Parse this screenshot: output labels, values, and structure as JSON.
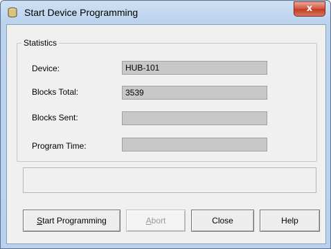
{
  "window": {
    "title": "Start Device Programming",
    "close_glyph": "x"
  },
  "statistics": {
    "legend": "Statistics",
    "rows": [
      {
        "label": "Device:",
        "value": "HUB-101"
      },
      {
        "label": "Blocks Total:",
        "value": "3539"
      },
      {
        "label": "Blocks Sent:",
        "value": ""
      },
      {
        "label": "Program Time:",
        "value": ""
      }
    ]
  },
  "status": {
    "text": ""
  },
  "buttons": {
    "start": {
      "accel": "S",
      "rest": "tart Programming"
    },
    "abort": {
      "accel": "A",
      "rest": "bort"
    },
    "close": "Close",
    "help": "Help"
  },
  "colors": {
    "close_button": "#c23b22",
    "field_bg": "#c8c8c8",
    "dialog_bg": "#f0f0f0"
  }
}
